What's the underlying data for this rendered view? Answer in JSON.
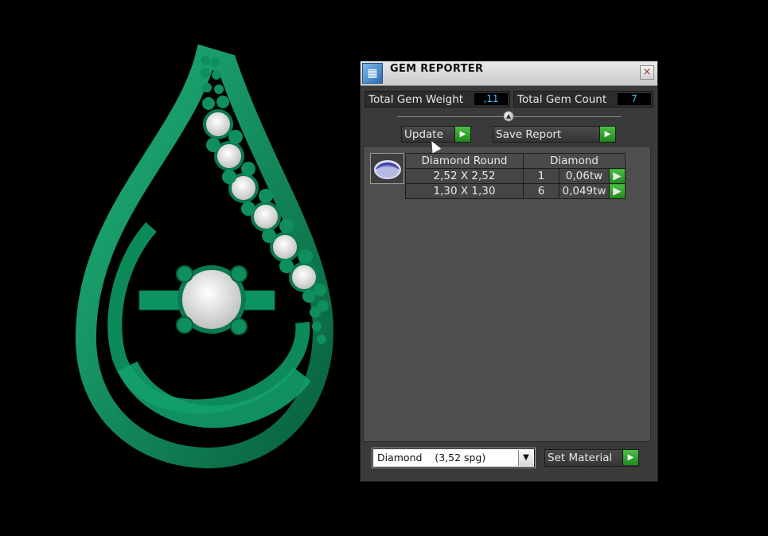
{
  "window": {
    "title": "GEM REPORTER",
    "close_glyph": "×"
  },
  "stats": {
    "total_weight_label": "Total Gem Weight",
    "total_weight_value": ",11",
    "total_count_label": "Total Gem Count",
    "total_count_value": "7"
  },
  "actions": {
    "update_label": "Update",
    "save_report_label": "Save Report"
  },
  "gem_table": {
    "headers": [
      "Diamond Round",
      "Diamond"
    ],
    "rows": [
      {
        "size": "2,52 X 2,52",
        "count": "1",
        "weight": "0,06tw"
      },
      {
        "size": "1,30 X 1,30",
        "count": "6",
        "weight": "0,049tw"
      }
    ]
  },
  "material": {
    "selected": "Diamond    (3,52 spg)",
    "set_label": "Set Material"
  },
  "colors": {
    "metal": "#0f8f5e",
    "value_text": "#3ec3ff",
    "play_button": "#2fa02a"
  },
  "icons": {
    "app": "gem-reporter-icon",
    "play": "play-icon",
    "dropdown": "chevron-down-icon",
    "close": "close-icon"
  }
}
